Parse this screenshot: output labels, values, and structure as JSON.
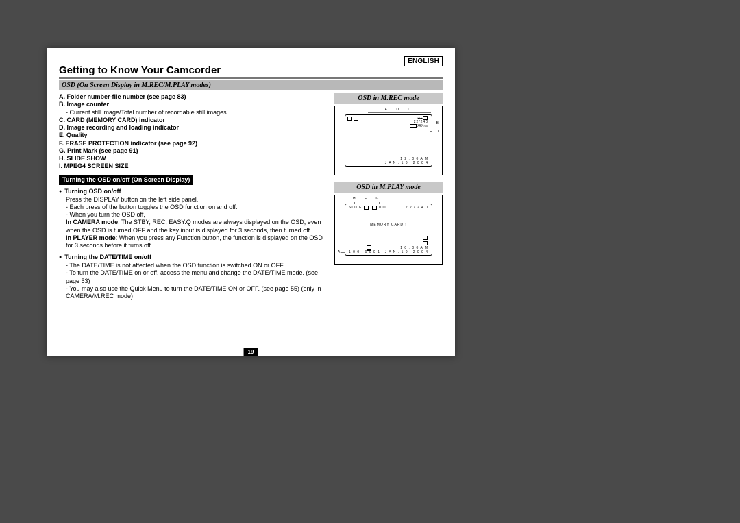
{
  "lang": "ENGLISH",
  "title": "Getting to Know Your Camcorder",
  "subtitle": "OSD (On Screen Display in M.REC/M.PLAY modes)",
  "listA": "A. Folder number-file number (see page 83)",
  "listB": "B. Image counter",
  "listB_sub": "- Current still image/Total number of recordable still images.",
  "listC": "C. CARD (MEMORY CARD) indicator",
  "listD": "D. Image recording and loading indicator",
  "listE": "E. Quality",
  "listF": "F. ERASE PROTECTION indicator (see page 92)",
  "listG": "G. Print Mark (see page 91)",
  "listH": "H. SLIDE SHOW",
  "listI": "I.  MPEG4 SCREEN SIZE",
  "blackbox": "Turning the OSD on/off (On Screen Display)",
  "bullet1": "Turning OSD on/off",
  "b1_line1": "Press the DISPLAY button on the left side panel.",
  "b1_line2": "- Each press of the button toggles the OSD function on and off.",
  "b1_line3": "- When you turn the OSD off,",
  "b1_cam_b": "In CAMERA mode",
  "b1_cam_t": ": The STBY, REC, EASY.Q modes are always displayed on the OSD, even when the OSD is turned OFF and the key input is displayed for 3 seconds, then turned off.",
  "b1_play_b": "In PLAYER mode",
  "b1_play_t": ": When you press any Function button, the function is displayed on the OSD for 3 seconds before it turns off.",
  "bullet2": "Turning the DATE/TIME on/off",
  "b2_line1": "- The DATE/TIME is not affected when the OSD function is switched ON or OFF.",
  "b2_line2": "- To turn the DATE/TIME on or off, access the menu and change the DATE/TIME mode. (see page 53)",
  "b2_line3": "- You may also use the Quick Menu to turn the DATE/TIME ON or OFF. (see page 55) (only in CAMERA/M.REC mode)",
  "side1": "OSD in M.REC mode",
  "side2": "OSD in M.PLAY mode",
  "d1": {
    "markers_top": "E   D   C",
    "mid": "22/240",
    "size": "352",
    "B": "B",
    "I": "I",
    "time": "1 2 : 0 0 A M",
    "date": "J A N . 1 0 , 2 0 0 4"
  },
  "d2": {
    "markers_top": "H   F   G",
    "slide": "SLIDE",
    "num": "001",
    "right": "2 2 / 2 4 0",
    "memcard": "MEMORY CARD !",
    "A": "A",
    "file": "1 0 0 - 0 0 0 1",
    "time": "1 0 : 0 0 A M",
    "date": "J A N . 1 0 , 2 0 0 4"
  },
  "pagenum": "19"
}
